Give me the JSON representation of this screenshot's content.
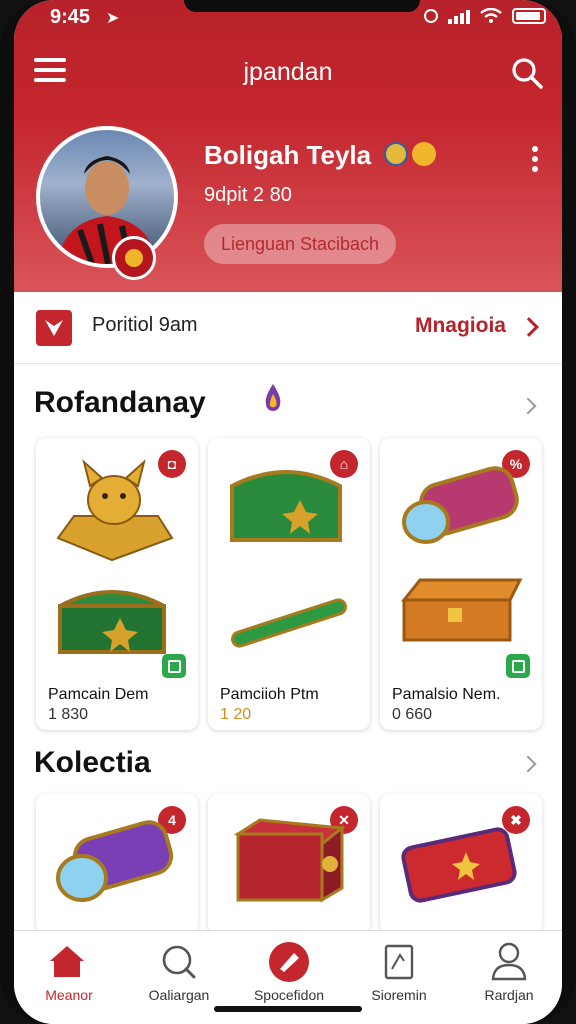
{
  "status": {
    "time": "9:45"
  },
  "header": {
    "title": "jpandan"
  },
  "profile": {
    "name": "Boligah Teyla",
    "subtitle": "9dpit 2 80",
    "pill_label": "Lienguan Stacibach"
  },
  "portfolio": {
    "label": "Poritiol 9am",
    "action": "Mnagioia"
  },
  "sections": {
    "first": {
      "title": "Rofandanay",
      "items": [
        {
          "icon": "golden-fox-statue-icon",
          "badge": "◘"
        },
        {
          "icon": "green-treasure-chest-icon",
          "badge": "⌂"
        },
        {
          "icon": "blue-crystal-cannon-icon",
          "badge": "%"
        },
        {
          "icon": "green-treasure-chest-icon",
          "name": "Pamcain Dem",
          "price": "1 830"
        },
        {
          "icon": "green-staff-icon",
          "name": "Pamciioh Ptm",
          "price": "1 20"
        },
        {
          "icon": "golden-chest-icon",
          "name": "Pamalsio Nem.",
          "price": "0 660"
        }
      ]
    },
    "second": {
      "title": "Kolectia",
      "items": [
        {
          "icon": "purple-crystal-cannon-icon",
          "badge": "4"
        },
        {
          "icon": "red-box-icon",
          "badge": "✕"
        },
        {
          "icon": "red-case-icon",
          "badge": "✖"
        }
      ]
    }
  },
  "nav": [
    {
      "label": "Meanor",
      "icon": "home-icon",
      "active": true
    },
    {
      "label": "Oaliargan",
      "icon": "search-magnifier-icon",
      "active": false
    },
    {
      "label": "Spocefidon",
      "icon": "brush-icon",
      "active": false
    },
    {
      "label": "Sioremin",
      "icon": "document-icon",
      "active": false
    },
    {
      "label": "Rardjan",
      "icon": "profile-icon",
      "active": false
    }
  ],
  "colors": {
    "brand_red": "#c4262d",
    "green_badge": "#2ba84a",
    "gold": "#d9a22f"
  }
}
